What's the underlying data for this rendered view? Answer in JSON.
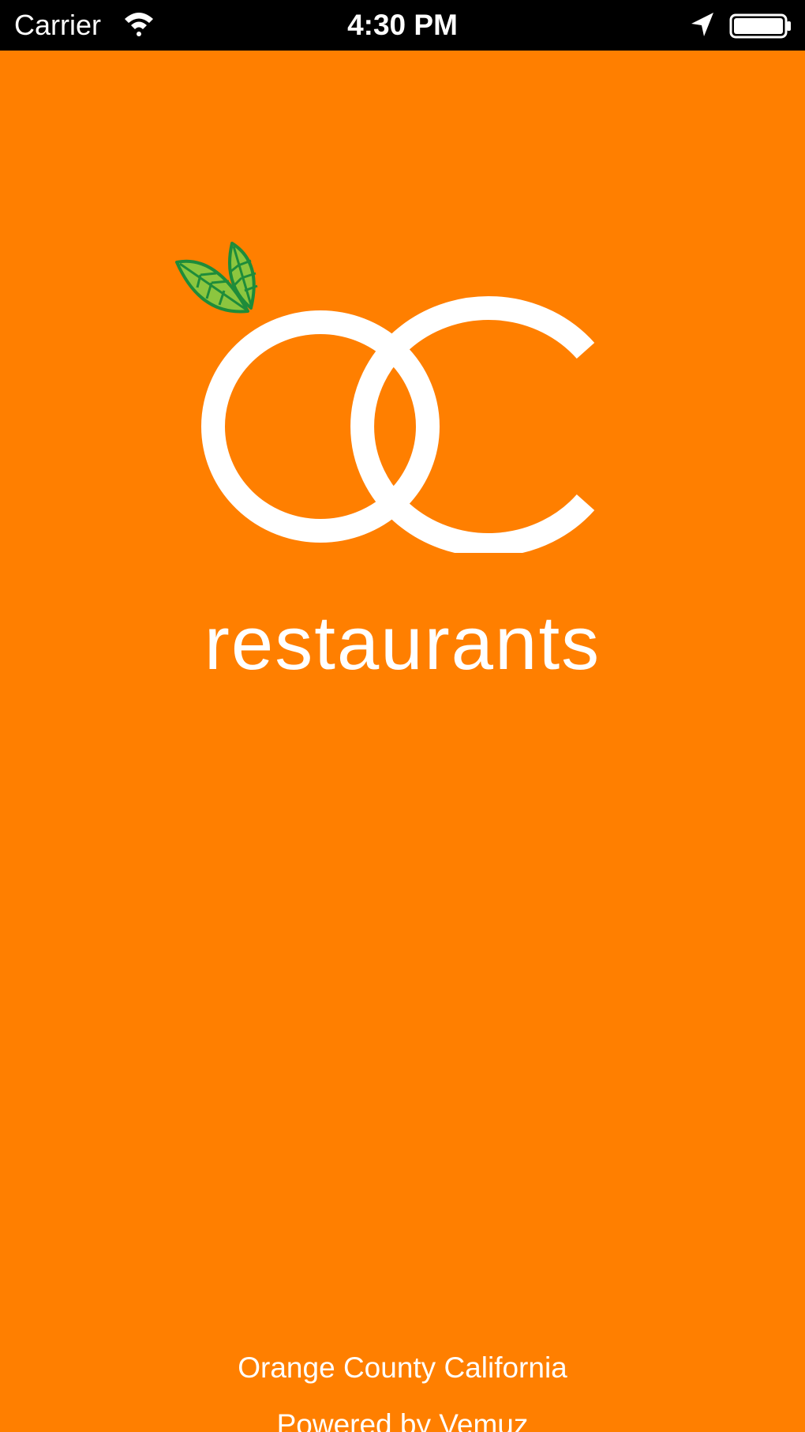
{
  "status_bar": {
    "carrier": "Carrier",
    "time": "4:30 PM",
    "icons": [
      "wifi-icon",
      "location-arrow-icon",
      "battery-icon"
    ]
  },
  "splash": {
    "logo_text": "OC",
    "wordmark": "restaurants",
    "region": "Orange County California",
    "powered_by": "Powered by Vemuz"
  },
  "colors": {
    "background": "#FF7F00",
    "status_bar": "#000000",
    "text": "#FFFFFF",
    "leaf_fill": "#8CC63F",
    "leaf_stroke": "#1E8C3A"
  }
}
